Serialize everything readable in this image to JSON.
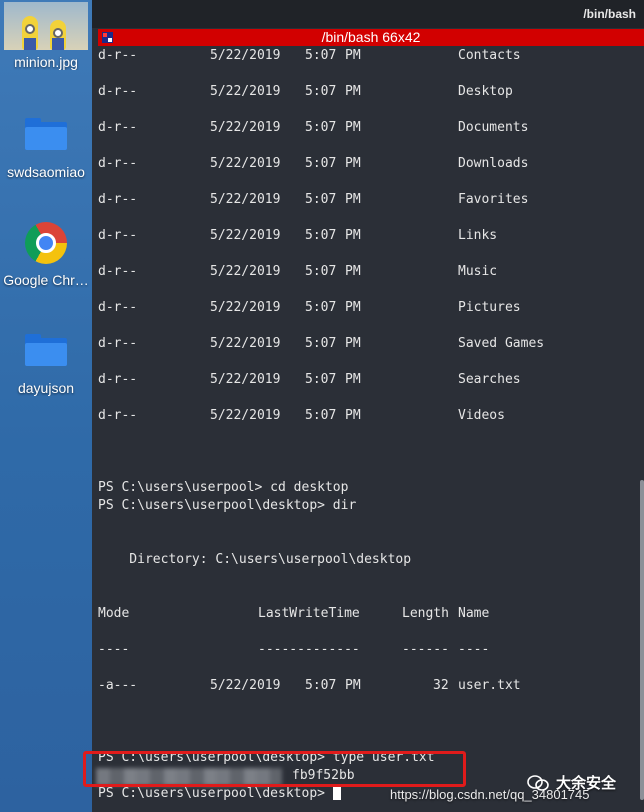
{
  "desktop": {
    "items": [
      {
        "label": "minion.jpg",
        "icon": "image-thumbnail-icon"
      },
      {
        "label": "swdsaomiao",
        "icon": "folder-icon"
      },
      {
        "label": "Google Chr…",
        "icon": "chrome-icon"
      },
      {
        "label": "dayujson",
        "icon": "folder-icon"
      }
    ]
  },
  "window": {
    "title": "/bin/bash",
    "tab_title": "/bin/bash 66x42"
  },
  "listing": {
    "rows": [
      {
        "mode": "d-r--",
        "date": "5/22/2019",
        "time": "5:07",
        "ampm": "PM",
        "name": "Contacts"
      },
      {
        "mode": "d-r--",
        "date": "5/22/2019",
        "time": "5:07",
        "ampm": "PM",
        "name": "Desktop"
      },
      {
        "mode": "d-r--",
        "date": "5/22/2019",
        "time": "5:07",
        "ampm": "PM",
        "name": "Documents"
      },
      {
        "mode": "d-r--",
        "date": "5/22/2019",
        "time": "5:07",
        "ampm": "PM",
        "name": "Downloads"
      },
      {
        "mode": "d-r--",
        "date": "5/22/2019",
        "time": "5:07",
        "ampm": "PM",
        "name": "Favorites"
      },
      {
        "mode": "d-r--",
        "date": "5/22/2019",
        "time": "5:07",
        "ampm": "PM",
        "name": "Links"
      },
      {
        "mode": "d-r--",
        "date": "5/22/2019",
        "time": "5:07",
        "ampm": "PM",
        "name": "Music"
      },
      {
        "mode": "d-r--",
        "date": "5/22/2019",
        "time": "5:07",
        "ampm": "PM",
        "name": "Pictures"
      },
      {
        "mode": "d-r--",
        "date": "5/22/2019",
        "time": "5:07",
        "ampm": "PM",
        "name": "Saved Games"
      },
      {
        "mode": "d-r--",
        "date": "5/22/2019",
        "time": "5:07",
        "ampm": "PM",
        "name": "Searches"
      },
      {
        "mode": "d-r--",
        "date": "5/22/2019",
        "time": "5:07",
        "ampm": "PM",
        "name": "Videos"
      }
    ]
  },
  "session": {
    "cmd_cd": "PS C:\\users\\userpool> cd desktop",
    "cmd_dir": "PS C:\\users\\userpool\\desktop> dir",
    "directory_line": "    Directory: C:\\users\\userpool\\desktop",
    "header": {
      "mode": "Mode",
      "lwt": "LastWriteTime",
      "length": "Length",
      "name": "Name"
    },
    "dashes": {
      "mode": "----",
      "lwt": "-------------",
      "length": "------",
      "name": "----"
    },
    "file_row": {
      "mode": "-a---",
      "date": "5/22/2019",
      "time": "5:07",
      "ampm": "PM",
      "length": "32",
      "name": "user.txt"
    },
    "cmd_type": "PS C:\\users\\userpool\\desktop> type user.txt",
    "hash_visible": "fb9f52bb",
    "prompt": "PS C:\\users\\userpool\\desktop> "
  },
  "overlay": {
    "watermark": "大余安全",
    "url": "https://blog.csdn.net/qq_34801745"
  },
  "colors": {
    "terminal_bg": "#2b2f37",
    "tab_red": "#d20000",
    "highlight_red": "#e01b1b",
    "text": "#e6e6e6"
  }
}
